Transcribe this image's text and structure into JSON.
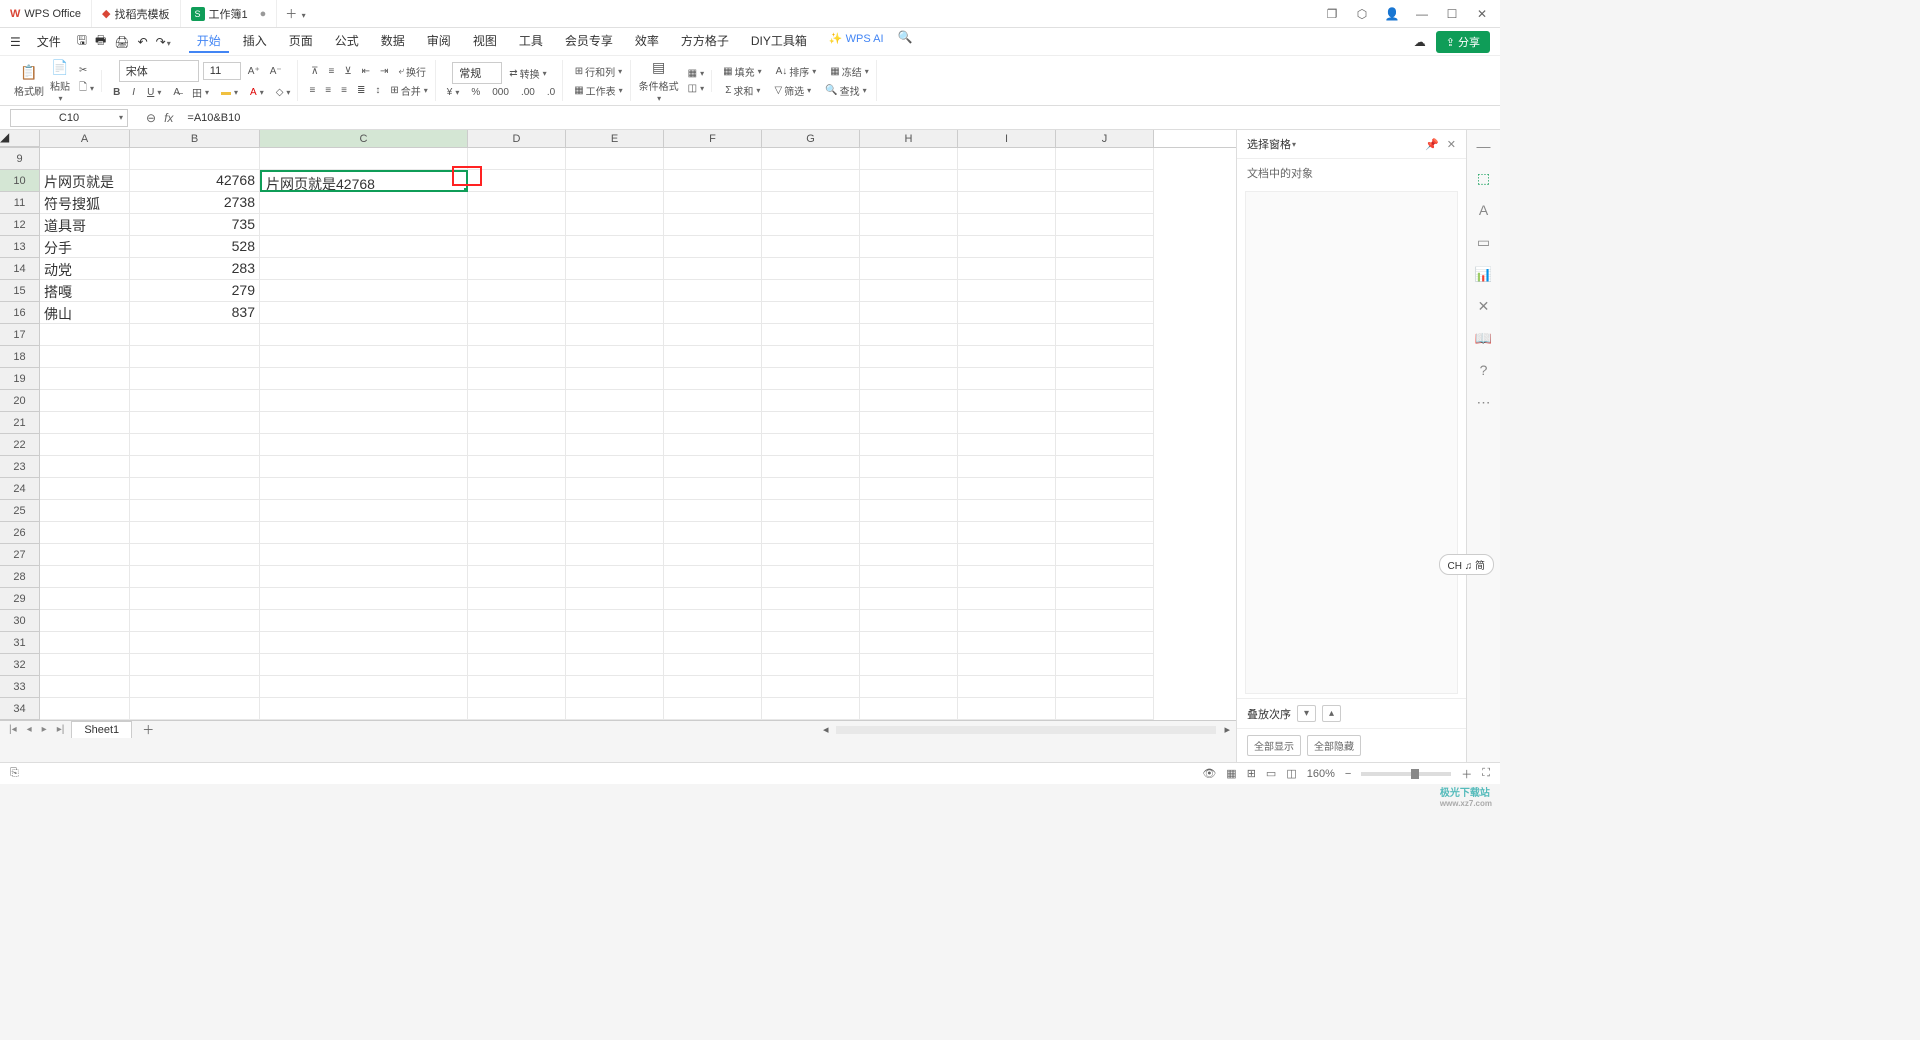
{
  "title_bar": {
    "app_name": "WPS Office",
    "tab_template": "找稻壳模板",
    "doc_tab": "工作簿1",
    "doc_icon": "S"
  },
  "menu": {
    "file": "文件",
    "tabs": [
      "开始",
      "插入",
      "页面",
      "公式",
      "数据",
      "审阅",
      "视图",
      "工具",
      "会员专享",
      "效率",
      "方方格子",
      "DIY工具箱"
    ],
    "ai": "WPS AI",
    "share": "分享"
  },
  "ribbon": {
    "format_painter": "格式刷",
    "paste": "粘贴",
    "font_name": "宋体",
    "font_size": "11",
    "wrap": "换行",
    "merge": "合并",
    "num_fmt": "常规",
    "convert": "转换",
    "rowcol": "行和列",
    "worksheet": "工作表",
    "cond_fmt": "条件格式",
    "fill": "填充",
    "sort": "排序",
    "freeze": "冻结",
    "sum": "求和",
    "filter": "筛选",
    "find": "查找"
  },
  "fx": {
    "name_box": "C10",
    "formula": "=A10&B10"
  },
  "columns": [
    "A",
    "B",
    "C",
    "D",
    "E",
    "F",
    "G",
    "H",
    "I",
    "J"
  ],
  "row_start": 9,
  "row_end": 34,
  "cells": {
    "A10": "片网页就是",
    "B10": "42768",
    "C10": "片网页就是42768",
    "A11": "符号搜狐",
    "B11": "2738",
    "A12": "道具哥",
    "B12": "735",
    "A13": "分手",
    "B13": "528",
    "A14": "动党",
    "B14": "283",
    "A15": "搭嘎",
    "B15": "279",
    "A16": "佛山",
    "B16": "837"
  },
  "side_panel": {
    "title": "选择窗格",
    "subtitle": "文档中的对象",
    "stack_order": "叠放次序",
    "show_all": "全部显示",
    "hide_all": "全部隐藏"
  },
  "sheet_tabs": {
    "sheet1": "Sheet1"
  },
  "status": {
    "zoom": "160%",
    "ime": "CH ♫ 简"
  },
  "watermark": {
    "brand": "极光下载站",
    "url": "www.xz7.com"
  }
}
